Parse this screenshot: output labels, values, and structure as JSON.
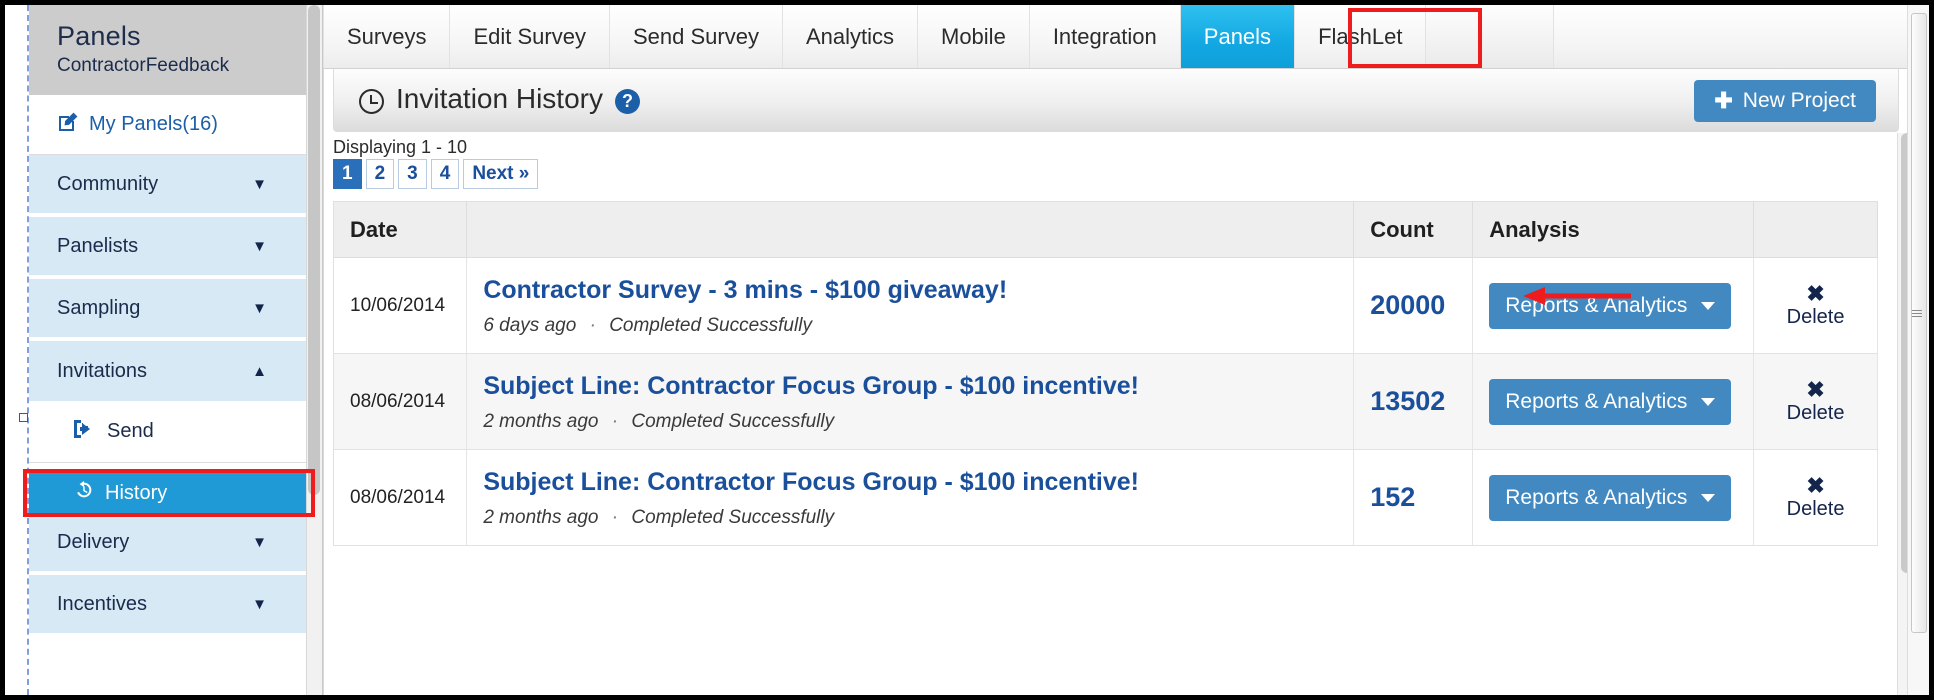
{
  "sidebar": {
    "title": "Panels",
    "subtitle": "ContractorFeedback",
    "items": [
      {
        "label": "My Panels(16)",
        "icon": "edit-square-icon",
        "style": "white",
        "caret": ""
      },
      {
        "label": "Community",
        "icon": "",
        "style": "group",
        "caret": "▼"
      },
      {
        "label": "Panelists",
        "icon": "",
        "style": "group",
        "caret": "▼"
      },
      {
        "label": "Sampling",
        "icon": "",
        "style": "group",
        "caret": "▼"
      },
      {
        "label": "Invitations",
        "icon": "",
        "style": "group",
        "caret": "▲"
      },
      {
        "label": "Send",
        "icon": "sign-out-icon",
        "style": "sub-white",
        "caret": ""
      },
      {
        "label": "History",
        "icon": "history-icon",
        "style": "sub-active",
        "caret": ""
      },
      {
        "label": "Delivery",
        "icon": "",
        "style": "group",
        "caret": "▼"
      },
      {
        "label": "Incentives",
        "icon": "",
        "style": "group",
        "caret": "▼"
      }
    ],
    "active_item": "History"
  },
  "tabs": [
    {
      "label": "Surveys",
      "active": false
    },
    {
      "label": "Edit Survey",
      "active": false
    },
    {
      "label": "Send Survey",
      "active": false
    },
    {
      "label": "Analytics",
      "active": false
    },
    {
      "label": "Mobile",
      "active": false
    },
    {
      "label": "Integration",
      "active": false
    },
    {
      "label": "Panels",
      "active": true
    },
    {
      "label": "FlashLet",
      "active": false
    }
  ],
  "page": {
    "title": "Invitation History",
    "clock_icon": "clock-icon",
    "help_icon": "question-mark-icon",
    "new_project_label": "New Project",
    "new_project_plus": "✚",
    "displaying": "Displaying 1 - 10"
  },
  "pagination": {
    "pages": [
      "1",
      "2",
      "3",
      "4"
    ],
    "current": "1",
    "next_label": "Next »"
  },
  "table": {
    "headers": [
      "Date",
      "",
      "Count",
      "Analysis",
      ""
    ],
    "rows": [
      {
        "date": "10/06/2014",
        "title": "Contractor Survey - 3 mins - $100 giveaway!",
        "age": "6 days ago",
        "separator": "·",
        "status": "Completed Successfully",
        "count": "20000",
        "analysis_label": "Reports & Analytics",
        "delete_label": "Delete",
        "delete_icon": "✖"
      },
      {
        "date": "08/06/2014",
        "title": "Subject Line: Contractor Focus Group - $100 incentive!",
        "age": "2 months ago",
        "separator": "·",
        "status": "Completed Successfully",
        "count": "13502",
        "analysis_label": "Reports & Analytics",
        "delete_label": "Delete",
        "delete_icon": "✖"
      },
      {
        "date": "08/06/2014",
        "title": "Subject Line: Contractor Focus Group - $100 incentive!",
        "age": "2 months ago",
        "separator": "·",
        "status": "Completed Successfully",
        "count": "152",
        "analysis_label": "Reports & Analytics",
        "delete_label": "Delete",
        "delete_icon": "✖"
      }
    ]
  },
  "annotations": {
    "highlight_color": "#ee1c1c",
    "arrow_color": "#ee1c1c",
    "highlighted_tab": "Panels",
    "highlighted_sidebar_item": "History",
    "arrow_points_to": "Contractor Survey - 3 mins - $100 giveaway!"
  },
  "colors": {
    "accent_blue": "#1f9ad6",
    "button_blue": "#4289c1",
    "link_blue": "#1a4f9c",
    "sidebar_group": "#d6e9f5",
    "sidebar_header": "#cccccc"
  }
}
